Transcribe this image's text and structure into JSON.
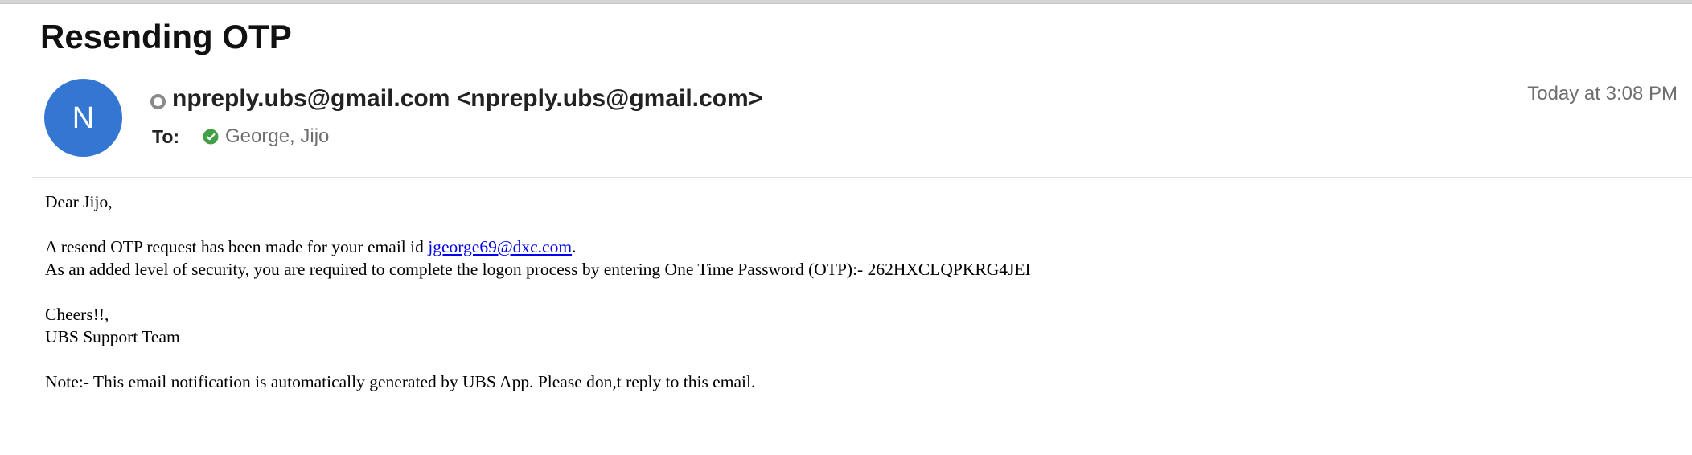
{
  "message": {
    "subject": "Resending OTP",
    "avatar_letter": "N",
    "sender": "npreply.ubs@gmail.com <npreply.ubs@gmail.com>",
    "to_label": "To:",
    "recipient": "George, Jijo",
    "date": "Today at 3:08 PM",
    "colors": {
      "avatar": "#3377d2",
      "link": "#0000ee",
      "verified_check": "#43a047"
    }
  },
  "body": {
    "greeting": "Dear Jijo,",
    "line1_before": "A resend OTP request has been made for your email id ",
    "line1_link": "jgeorge69@dxc.com",
    "line1_after": ".",
    "line2": "As an added level of security, you are required to complete the logon process by entering One Time Password (OTP):- 262HXCLQPKRG4JEI",
    "signoff": "Cheers!!,",
    "team": "UBS Support Team",
    "note": "Note:- This email notification is automatically generated by UBS App. Please don,t reply to this email."
  }
}
